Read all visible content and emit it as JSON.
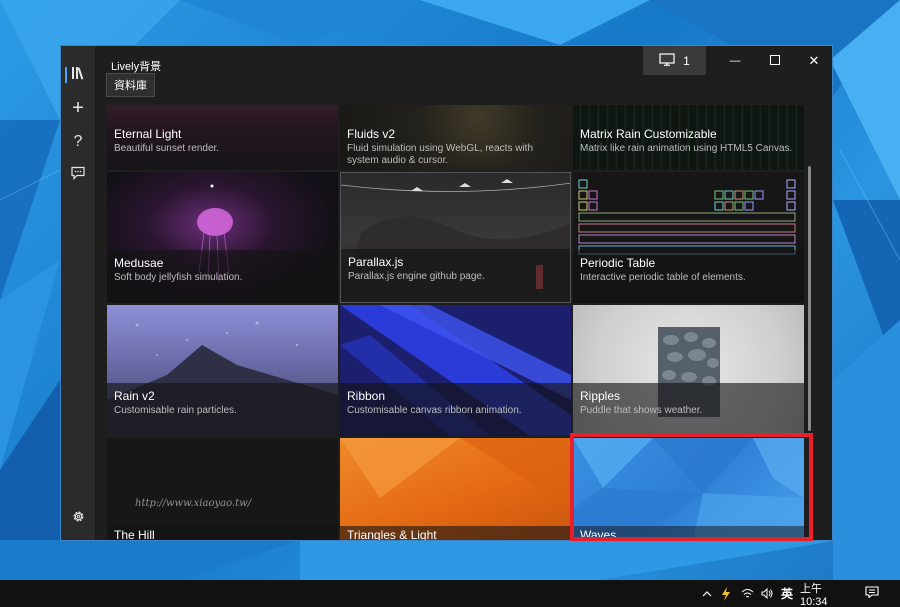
{
  "window": {
    "app_title": "Lively背景",
    "tooltip": "資料庫",
    "display_count": "1"
  },
  "caption_buttons": {
    "minimize": "—",
    "maximize": "☐",
    "close": "✕"
  },
  "nav": {
    "items": [
      {
        "name": "library",
        "icon": "library-icon",
        "active": true
      },
      {
        "name": "add",
        "icon": "plus-icon",
        "glyph": "+"
      },
      {
        "name": "help",
        "icon": "help-icon",
        "glyph": "?"
      },
      {
        "name": "feedback",
        "icon": "feedback-icon"
      }
    ],
    "settings_icon": "gear-icon"
  },
  "wallpapers": [
    {
      "title": "Eternal Light",
      "desc": "Beautiful sunset render."
    },
    {
      "title": "Fluids v2",
      "desc": "Fluid simulation using WebGL, reacts with system audio & cursor."
    },
    {
      "title": "Matrix Rain Customizable",
      "desc": "Matrix like rain animation using HTML5 Canvas."
    },
    {
      "title": "Medusae",
      "desc": "Soft body jellyfish simulation."
    },
    {
      "title": "Parallax.js",
      "desc": "Parallax.js engine github page."
    },
    {
      "title": "Periodic Table",
      "desc": "Interactive periodic table of elements."
    },
    {
      "title": "Rain v2",
      "desc": "Customisable rain particles."
    },
    {
      "title": "Ribbon",
      "desc": "Customisable canvas ribbon animation."
    },
    {
      "title": "Ripples",
      "desc": "Puddle that shows weather."
    },
    {
      "title": "The Hill",
      "desc": ""
    },
    {
      "title": "Triangles & Light",
      "desc": ""
    },
    {
      "title": "Waves",
      "desc": ""
    }
  ],
  "watermark": "http://www.xiaoyao.tw/",
  "taskbar": {
    "ime": "英",
    "time": "上午 10:34"
  },
  "colors": {
    "accent": "#4aa3ff",
    "highlight": "#e8202a",
    "window_bg": "#1e1e1e",
    "nav_bg": "#2b2b2b"
  }
}
